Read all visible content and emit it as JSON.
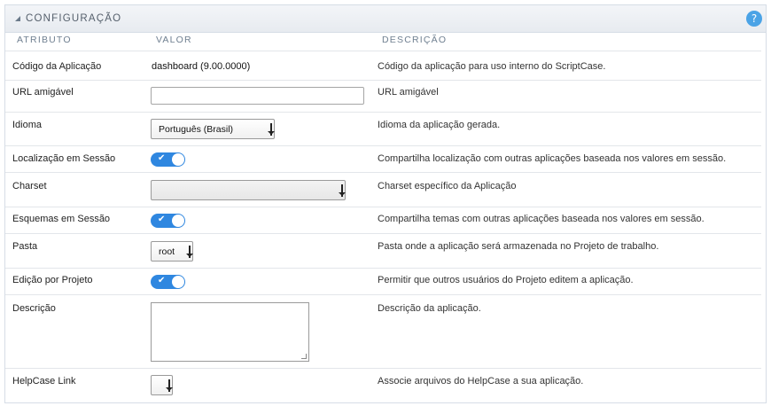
{
  "panel": {
    "title": "CONFIGURAÇÃO",
    "help_icon": "?"
  },
  "columns": {
    "attribute": "ATRIBUTO",
    "value": "VALOR",
    "description": "DESCRIÇÃO"
  },
  "rows": [
    {
      "label": "Código da Aplicação",
      "value": "dashboard (9.00.0000)",
      "description": "Código da aplicação para uso interno do ScriptCase."
    },
    {
      "label": "URL amigável",
      "input_value": "",
      "description": "URL amigável"
    },
    {
      "label": "Idioma",
      "selected": "Português (Brasil)",
      "description": "Idioma da aplicação gerada."
    },
    {
      "label": "Localização em Sessão",
      "toggle": true,
      "description": "Compartilha localização com outras aplicações baseada nos valores em sessão."
    },
    {
      "label": "Charset",
      "selected": "",
      "description": "Charset específico da Aplicação"
    },
    {
      "label": "Esquemas em Sessão",
      "toggle": true,
      "description": "Compartilha temas com outras aplicações baseada nos valores em sessão."
    },
    {
      "label": "Pasta",
      "selected": "root",
      "description": "Pasta onde a aplicação será armazenada no Projeto de trabalho."
    },
    {
      "label": "Edição por Projeto",
      "toggle": true,
      "description": "Permitir que outros usuários do Projeto editem a aplicação."
    },
    {
      "label": "Descrição",
      "textarea_value": "",
      "description": "Descrição da aplicação."
    },
    {
      "label": "HelpCase Link",
      "selected": "",
      "description": "Associe arquivos do HelpCase a sua aplicação."
    }
  ],
  "colors": {
    "toggle_on": "#2f87e0",
    "help": "#4aa3e6"
  }
}
